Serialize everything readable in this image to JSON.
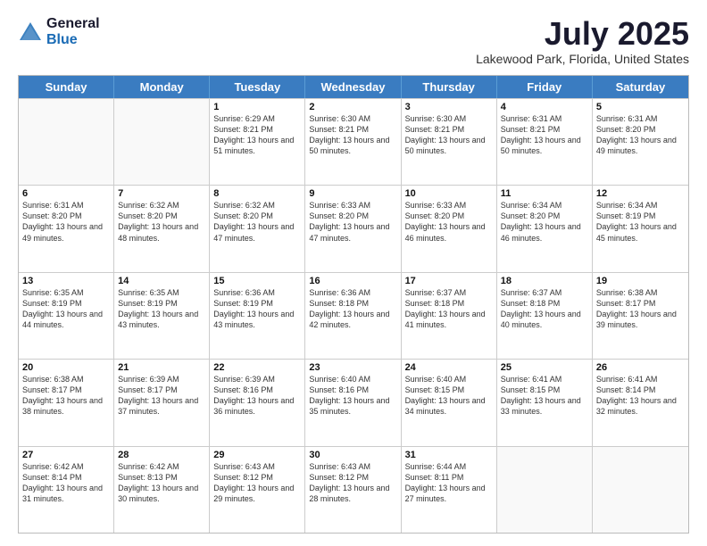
{
  "logo": {
    "general": "General",
    "blue": "Blue"
  },
  "title": {
    "month_year": "July 2025",
    "location": "Lakewood Park, Florida, United States"
  },
  "weekdays": [
    "Sunday",
    "Monday",
    "Tuesday",
    "Wednesday",
    "Thursday",
    "Friday",
    "Saturday"
  ],
  "weeks": [
    [
      {
        "day": "",
        "info": ""
      },
      {
        "day": "",
        "info": ""
      },
      {
        "day": "1",
        "info": "Sunrise: 6:29 AM\nSunset: 8:21 PM\nDaylight: 13 hours and 51 minutes."
      },
      {
        "day": "2",
        "info": "Sunrise: 6:30 AM\nSunset: 8:21 PM\nDaylight: 13 hours and 50 minutes."
      },
      {
        "day": "3",
        "info": "Sunrise: 6:30 AM\nSunset: 8:21 PM\nDaylight: 13 hours and 50 minutes."
      },
      {
        "day": "4",
        "info": "Sunrise: 6:31 AM\nSunset: 8:21 PM\nDaylight: 13 hours and 50 minutes."
      },
      {
        "day": "5",
        "info": "Sunrise: 6:31 AM\nSunset: 8:20 PM\nDaylight: 13 hours and 49 minutes."
      }
    ],
    [
      {
        "day": "6",
        "info": "Sunrise: 6:31 AM\nSunset: 8:20 PM\nDaylight: 13 hours and 49 minutes."
      },
      {
        "day": "7",
        "info": "Sunrise: 6:32 AM\nSunset: 8:20 PM\nDaylight: 13 hours and 48 minutes."
      },
      {
        "day": "8",
        "info": "Sunrise: 6:32 AM\nSunset: 8:20 PM\nDaylight: 13 hours and 47 minutes."
      },
      {
        "day": "9",
        "info": "Sunrise: 6:33 AM\nSunset: 8:20 PM\nDaylight: 13 hours and 47 minutes."
      },
      {
        "day": "10",
        "info": "Sunrise: 6:33 AM\nSunset: 8:20 PM\nDaylight: 13 hours and 46 minutes."
      },
      {
        "day": "11",
        "info": "Sunrise: 6:34 AM\nSunset: 8:20 PM\nDaylight: 13 hours and 46 minutes."
      },
      {
        "day": "12",
        "info": "Sunrise: 6:34 AM\nSunset: 8:19 PM\nDaylight: 13 hours and 45 minutes."
      }
    ],
    [
      {
        "day": "13",
        "info": "Sunrise: 6:35 AM\nSunset: 8:19 PM\nDaylight: 13 hours and 44 minutes."
      },
      {
        "day": "14",
        "info": "Sunrise: 6:35 AM\nSunset: 8:19 PM\nDaylight: 13 hours and 43 minutes."
      },
      {
        "day": "15",
        "info": "Sunrise: 6:36 AM\nSunset: 8:19 PM\nDaylight: 13 hours and 43 minutes."
      },
      {
        "day": "16",
        "info": "Sunrise: 6:36 AM\nSunset: 8:18 PM\nDaylight: 13 hours and 42 minutes."
      },
      {
        "day": "17",
        "info": "Sunrise: 6:37 AM\nSunset: 8:18 PM\nDaylight: 13 hours and 41 minutes."
      },
      {
        "day": "18",
        "info": "Sunrise: 6:37 AM\nSunset: 8:18 PM\nDaylight: 13 hours and 40 minutes."
      },
      {
        "day": "19",
        "info": "Sunrise: 6:38 AM\nSunset: 8:17 PM\nDaylight: 13 hours and 39 minutes."
      }
    ],
    [
      {
        "day": "20",
        "info": "Sunrise: 6:38 AM\nSunset: 8:17 PM\nDaylight: 13 hours and 38 minutes."
      },
      {
        "day": "21",
        "info": "Sunrise: 6:39 AM\nSunset: 8:17 PM\nDaylight: 13 hours and 37 minutes."
      },
      {
        "day": "22",
        "info": "Sunrise: 6:39 AM\nSunset: 8:16 PM\nDaylight: 13 hours and 36 minutes."
      },
      {
        "day": "23",
        "info": "Sunrise: 6:40 AM\nSunset: 8:16 PM\nDaylight: 13 hours and 35 minutes."
      },
      {
        "day": "24",
        "info": "Sunrise: 6:40 AM\nSunset: 8:15 PM\nDaylight: 13 hours and 34 minutes."
      },
      {
        "day": "25",
        "info": "Sunrise: 6:41 AM\nSunset: 8:15 PM\nDaylight: 13 hours and 33 minutes."
      },
      {
        "day": "26",
        "info": "Sunrise: 6:41 AM\nSunset: 8:14 PM\nDaylight: 13 hours and 32 minutes."
      }
    ],
    [
      {
        "day": "27",
        "info": "Sunrise: 6:42 AM\nSunset: 8:14 PM\nDaylight: 13 hours and 31 minutes."
      },
      {
        "day": "28",
        "info": "Sunrise: 6:42 AM\nSunset: 8:13 PM\nDaylight: 13 hours and 30 minutes."
      },
      {
        "day": "29",
        "info": "Sunrise: 6:43 AM\nSunset: 8:12 PM\nDaylight: 13 hours and 29 minutes."
      },
      {
        "day": "30",
        "info": "Sunrise: 6:43 AM\nSunset: 8:12 PM\nDaylight: 13 hours and 28 minutes."
      },
      {
        "day": "31",
        "info": "Sunrise: 6:44 AM\nSunset: 8:11 PM\nDaylight: 13 hours and 27 minutes."
      },
      {
        "day": "",
        "info": ""
      },
      {
        "day": "",
        "info": ""
      }
    ]
  ]
}
